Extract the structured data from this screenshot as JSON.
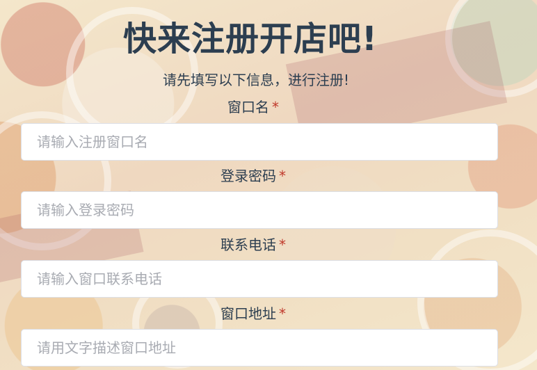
{
  "page": {
    "title": "快来注册开店吧!",
    "subtitle": "请先填写以下信息，进行注册!"
  },
  "form": {
    "required_mark": "*",
    "fields": [
      {
        "label": "窗口名",
        "placeholder": "请输入注册窗口名",
        "value": ""
      },
      {
        "label": "登录密码",
        "placeholder": "请输入登录密码",
        "value": ""
      },
      {
        "label": "联系电话",
        "placeholder": "请输入窗口联系电话",
        "value": ""
      },
      {
        "label": "窗口地址",
        "placeholder": "请用文字描述窗口地址",
        "value": ""
      }
    ]
  },
  "colors": {
    "title": "#2c3e50",
    "required": "#c0392b",
    "input_border": "#dcdfe6",
    "placeholder": "#a8abb2"
  }
}
